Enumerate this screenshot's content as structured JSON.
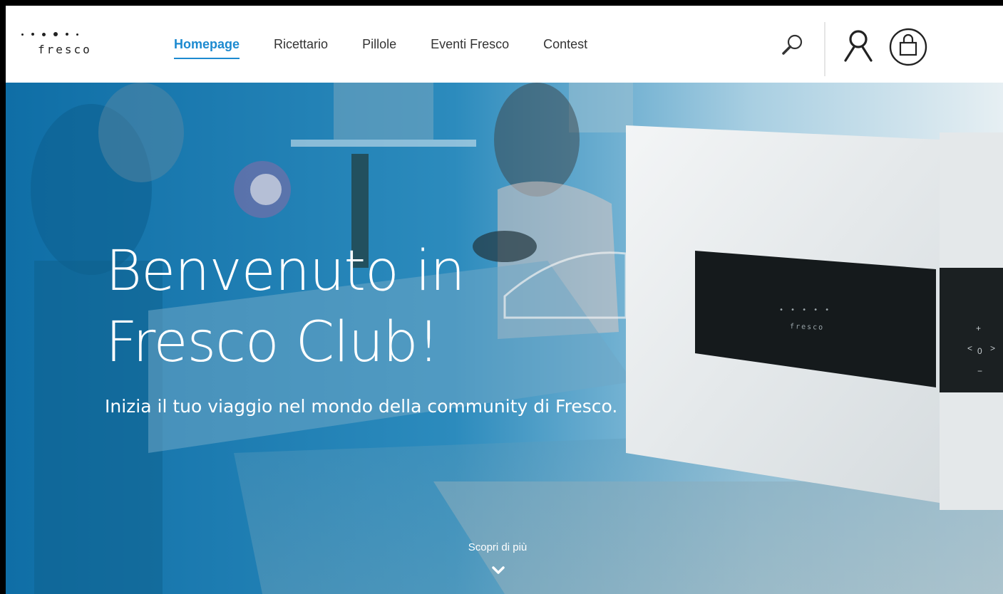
{
  "brand": {
    "name": "fresco"
  },
  "nav": {
    "items": [
      {
        "label": "Homepage",
        "active": true
      },
      {
        "label": "Ricettario",
        "active": false
      },
      {
        "label": "Pillole",
        "active": false
      },
      {
        "label": "Eventi Fresco",
        "active": false
      },
      {
        "label": "Contest",
        "active": false
      }
    ]
  },
  "header_icons": [
    "search-icon",
    "user-icon",
    "shopping-bag-icon"
  ],
  "hero": {
    "title_line1": "Benvenuto in",
    "title_line2": "Fresco Club!",
    "subtitle": "Inizia il tuo viaggio nel mondo della community di Fresco.",
    "cta_label": "Scopri di più",
    "device_brand": "fresco",
    "device_controls": [
      "+",
      "<",
      "0",
      ">",
      "−"
    ]
  },
  "colors": {
    "accent": "#1c8ad0",
    "hero_blue": "#1a79ad",
    "header_bg": "#ffffff",
    "text_dark": "#333333"
  }
}
